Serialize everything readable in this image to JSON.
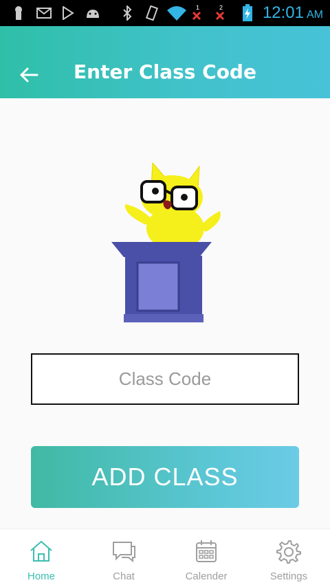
{
  "status_bar": {
    "time": "12:01",
    "ampm": "AM",
    "sim1_label": "1",
    "sim2_label": "2",
    "icons": [
      "keyhole-icon",
      "gmail-icon",
      "play-store-icon",
      "android-debug-icon",
      "bluetooth-icon",
      "vibrate-icon",
      "wifi-icon",
      "signal-sim1-icon",
      "signal-sim2-icon",
      "battery-charging-icon"
    ],
    "time_color": "#33b5e5"
  },
  "app_bar": {
    "title": "Enter Class Code",
    "back_icon": "arrow-left-icon",
    "gradient_start": "#2fbfa8",
    "gradient_end": "#47c2d8"
  },
  "illustration": {
    "name": "owl-at-podium-illustration",
    "owl_color": "#f5ef1b",
    "podium_color": "#4a4fa8"
  },
  "form": {
    "class_code_placeholder": "Class Code",
    "class_code_value": "",
    "add_button_label": "ADD CLASS"
  },
  "bottom_nav": {
    "items": [
      {
        "label": "Home",
        "icon": "home-icon",
        "active": true
      },
      {
        "label": "Chat",
        "icon": "chat-icon",
        "active": false
      },
      {
        "label": "Calender",
        "icon": "calendar-icon",
        "active": false
      },
      {
        "label": "Settings",
        "icon": "gear-icon",
        "active": false
      }
    ],
    "active_color": "#3bbfb0",
    "inactive_color": "#9e9e9e"
  }
}
